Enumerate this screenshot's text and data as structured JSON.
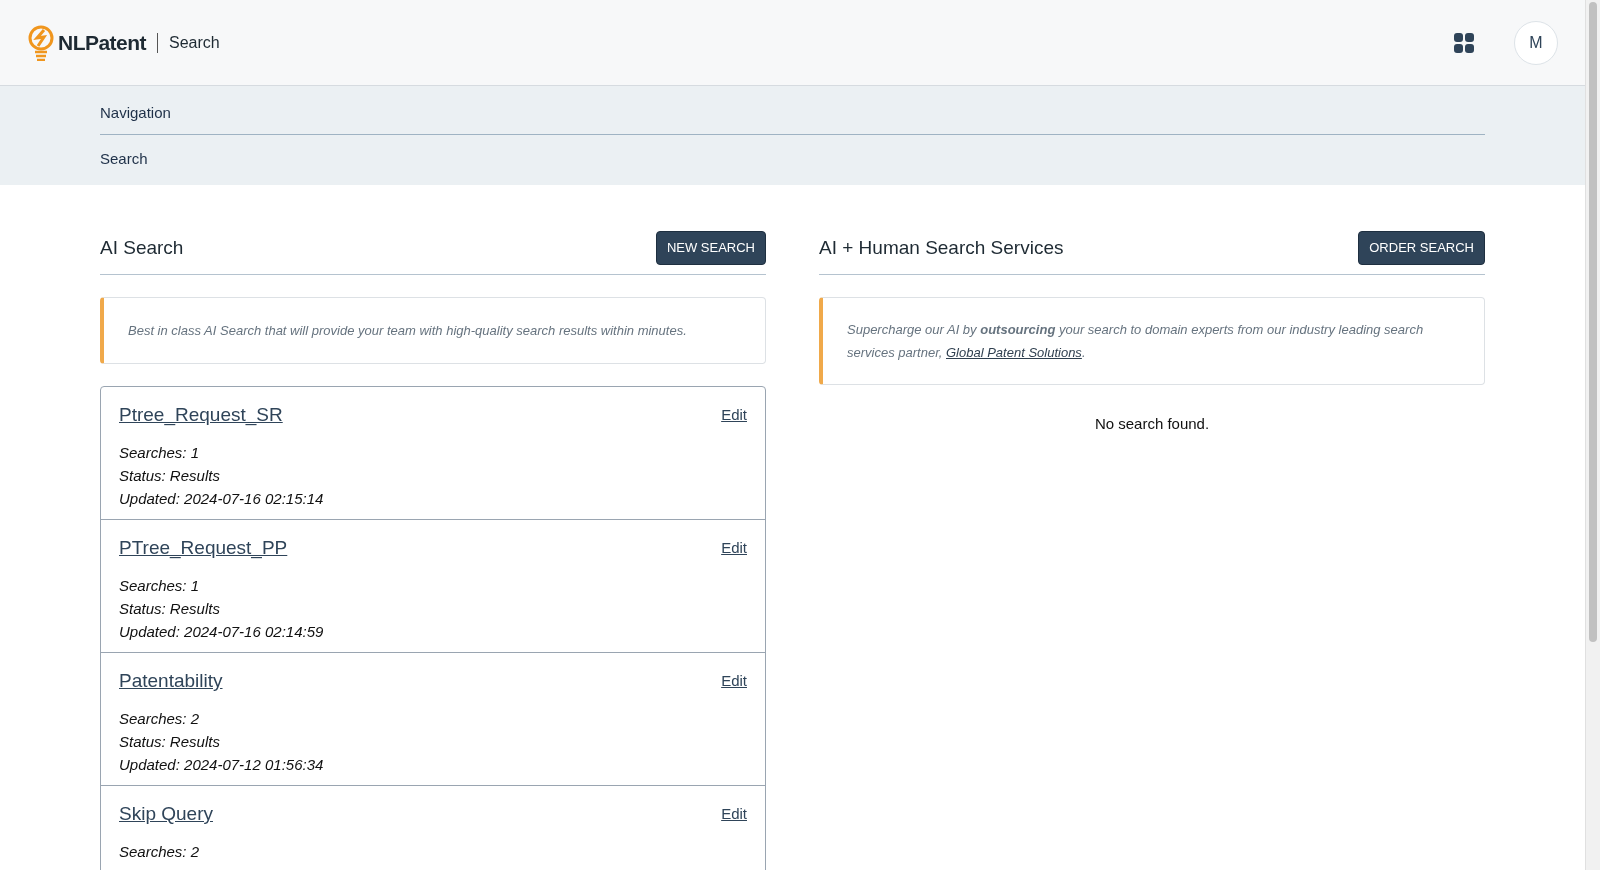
{
  "header": {
    "brand": "NLPatent",
    "section": "Search",
    "avatar": "M"
  },
  "breadcrumb": {
    "title": "Navigation",
    "items": [
      "Search"
    ]
  },
  "ai_search": {
    "title": "AI Search",
    "button": "NEW SEARCH",
    "intro": "Best in class AI Search that will provide your team with high-quality search results within minutes.",
    "cards": [
      {
        "name": "Ptree_Request_SR",
        "edit": "Edit",
        "lines": [
          "Searches: 1",
          "Status: Results",
          "Updated: 2024-07-16 02:15:14"
        ]
      },
      {
        "name": "PTree_Request_PP",
        "edit": "Edit",
        "lines": [
          "Searches: 1",
          "Status: Results",
          "Updated: 2024-07-16 02:14:59"
        ]
      },
      {
        "name": "Patentability",
        "edit": "Edit",
        "lines": [
          "Searches: 2",
          "Status: Results",
          "Updated: 2024-07-12 01:56:34"
        ]
      },
      {
        "name": "Skip Query",
        "edit": "Edit",
        "lines": [
          "Searches: 2"
        ]
      }
    ]
  },
  "services": {
    "title": "AI + Human Search Services",
    "button": "ORDER SEARCH",
    "intro": "Supercharge our AI by **outsourcing** your search to domain experts from our industry leading search services partner, ",
    "intro_link": "Global Patent Solutions",
    "intro_end": ".",
    "empty": "No search found."
  }
}
